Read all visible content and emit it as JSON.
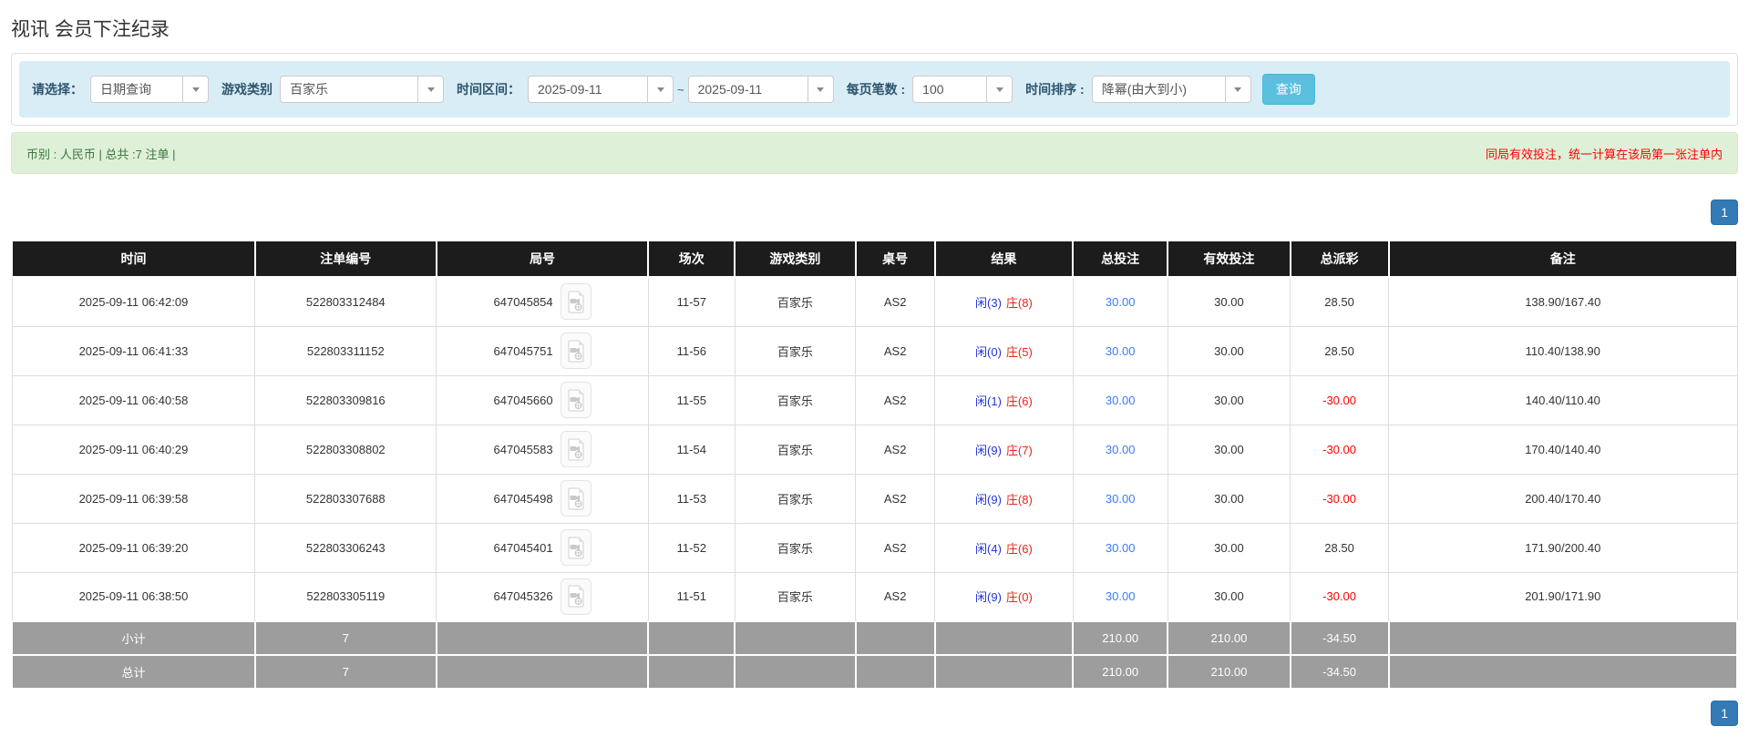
{
  "page": {
    "title": "视讯 会员下注纪录"
  },
  "filters": {
    "select_label": "请选择：",
    "select_value": "日期查询",
    "game_type_label": "游戏类别",
    "game_type_value": "百家乐",
    "date_range_label": "时间区间：",
    "date_from": "2025-09-11",
    "date_separator": "~",
    "date_to": "2025-09-11",
    "page_size_label": "每页笔数 :",
    "page_size_value": "100",
    "sort_label": "时间排序 :",
    "sort_value": "降幂(由大到小)",
    "search_button": "查询"
  },
  "notice_bar": {
    "left_text": "币别 : 人民币 | 总共 :7 注单 |",
    "right_text": "同局有效投注，统一计算在该局第一张注单内"
  },
  "pagination": {
    "page": "1"
  },
  "table": {
    "headers": [
      "时间",
      "注单编号",
      "局号",
      "场次",
      "游戏类别",
      "桌号",
      "结果",
      "总投注",
      "有效投注",
      "总派彩",
      "备注"
    ],
    "rows": [
      {
        "time": "2025-09-11 06:42:09",
        "bet_id": "522803312484",
        "round_id": "647045854",
        "session": "11-57",
        "game": "百家乐",
        "table_no": "AS2",
        "result_player": "闲(3)",
        "result_banker": "庄(8)",
        "total_bet": "30.00",
        "valid_bet": "30.00",
        "payout": "28.50",
        "note": "138.90/167.40"
      },
      {
        "time": "2025-09-11 06:41:33",
        "bet_id": "522803311152",
        "round_id": "647045751",
        "session": "11-56",
        "game": "百家乐",
        "table_no": "AS2",
        "result_player": "闲(0)",
        "result_banker": "庄(5)",
        "total_bet": "30.00",
        "valid_bet": "30.00",
        "payout": "28.50",
        "note": "110.40/138.90"
      },
      {
        "time": "2025-09-11 06:40:58",
        "bet_id": "522803309816",
        "round_id": "647045660",
        "session": "11-55",
        "game": "百家乐",
        "table_no": "AS2",
        "result_player": "闲(1)",
        "result_banker": "庄(6)",
        "total_bet": "30.00",
        "valid_bet": "30.00",
        "payout": "-30.00",
        "note": "140.40/110.40"
      },
      {
        "time": "2025-09-11 06:40:29",
        "bet_id": "522803308802",
        "round_id": "647045583",
        "session": "11-54",
        "game": "百家乐",
        "table_no": "AS2",
        "result_player": "闲(9)",
        "result_banker": "庄(7)",
        "total_bet": "30.00",
        "valid_bet": "30.00",
        "payout": "-30.00",
        "note": "170.40/140.40"
      },
      {
        "time": "2025-09-11 06:39:58",
        "bet_id": "522803307688",
        "round_id": "647045498",
        "session": "11-53",
        "game": "百家乐",
        "table_no": "AS2",
        "result_player": "闲(9)",
        "result_banker": "庄(8)",
        "total_bet": "30.00",
        "valid_bet": "30.00",
        "payout": "-30.00",
        "note": "200.40/170.40"
      },
      {
        "time": "2025-09-11 06:39:20",
        "bet_id": "522803306243",
        "round_id": "647045401",
        "session": "11-52",
        "game": "百家乐",
        "table_no": "AS2",
        "result_player": "闲(4)",
        "result_banker": "庄(6)",
        "total_bet": "30.00",
        "valid_bet": "30.00",
        "payout": "28.50",
        "note": "171.90/200.40"
      },
      {
        "time": "2025-09-11 06:38:50",
        "bet_id": "522803305119",
        "round_id": "647045326",
        "session": "11-51",
        "game": "百家乐",
        "table_no": "AS2",
        "result_player": "闲(9)",
        "result_banker": "庄(0)",
        "total_bet": "30.00",
        "valid_bet": "30.00",
        "payout": "-30.00",
        "note": "201.90/171.90"
      }
    ],
    "subtotal": {
      "label": "小计",
      "count": "7",
      "total_bet": "210.00",
      "valid_bet": "210.00",
      "payout": "-34.50"
    },
    "total": {
      "label": "总计",
      "count": "7",
      "total_bet": "210.00",
      "valid_bet": "210.00",
      "payout": "-34.50"
    }
  },
  "icons": {
    "video_replay": "video-file-icon",
    "dropdown": "chevron-down-icon"
  },
  "colors": {
    "filter_bar_bg": "#d9edf7",
    "search_button": "#5bc0de",
    "notice_bg": "#dff0d8",
    "notice_text": "#3c763d",
    "notice_warning_red": "#ff0000",
    "header_bg": "#1c1c1c",
    "summary_bg": "#9d9d9d",
    "pagination_blue": "#337ab7",
    "link_blue": "#3b7cf5",
    "player_blue": "#2233dd",
    "banker_red": "#ea241d",
    "negative_red": "#ff0000"
  }
}
